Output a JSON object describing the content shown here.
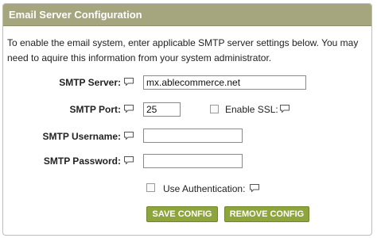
{
  "panel": {
    "title": "Email Server Configuration"
  },
  "intro_text": "To enable the email system, enter applicable SMTP server settings below. You may need to aquire this information from your system administrator.",
  "fields": {
    "server": {
      "label": "SMTP Server:",
      "value": "mx.ablecommerce.net",
      "help_icon": "comment-icon"
    },
    "port": {
      "label": "SMTP Port:",
      "value": "25",
      "help_icon": "comment-icon"
    },
    "ssl": {
      "label": "Enable SSL:",
      "checked": false,
      "help_icon": "comment-icon"
    },
    "username": {
      "label": "SMTP Username:",
      "value": "",
      "help_icon": "comment-icon"
    },
    "password": {
      "label": "SMTP Password:",
      "value": "",
      "help_icon": "comment-icon"
    },
    "auth": {
      "label": "Use Authentication:",
      "checked": false,
      "help_icon": "comment-icon"
    }
  },
  "buttons": {
    "save": "SAVE CONFIG",
    "remove": "REMOVE CONFIG"
  },
  "colors": {
    "header": "#a5a57e",
    "button": "#8ea43d"
  }
}
